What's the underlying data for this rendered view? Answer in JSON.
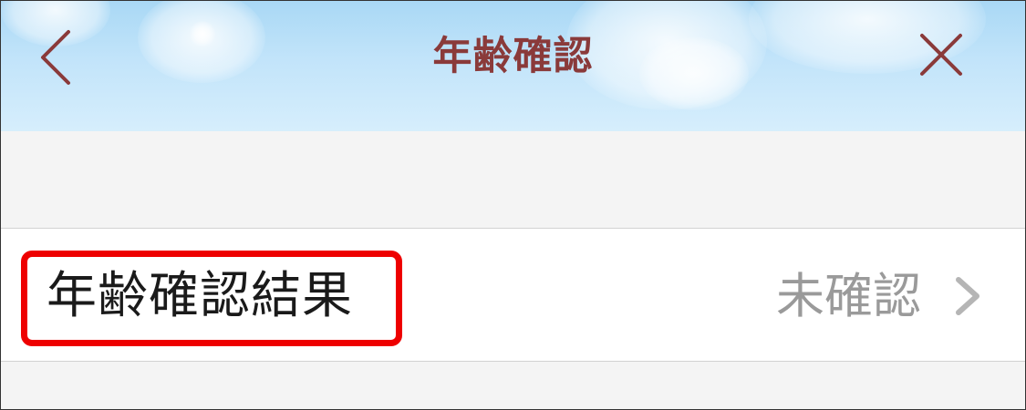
{
  "header": {
    "title": "年齢確認",
    "back_icon": "chevron-left-icon",
    "close_icon": "close-icon"
  },
  "row": {
    "label": "年齢確認結果",
    "value": "未確認",
    "chevron_icon": "chevron-right-icon"
  },
  "colors": {
    "title": "#8a3a3a",
    "header_sky": "#c2e4fa",
    "highlight": "#ee0000",
    "value_text": "#9a9a9a",
    "page_bg": "#f4f4f4"
  }
}
